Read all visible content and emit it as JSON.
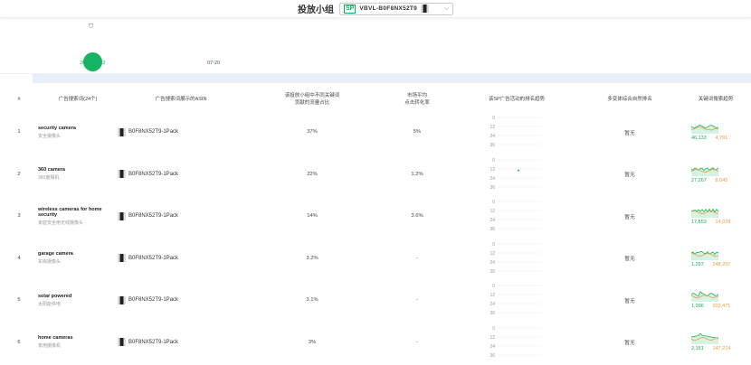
{
  "header": {
    "title": "投放小组",
    "badge": "SP",
    "selected_group": "VBVL-B0F8NX52T9"
  },
  "timeline": {
    "dates": [
      "2025-07-13",
      "07-20"
    ]
  },
  "table": {
    "columns": [
      "#",
      "广告搜索词(24个)",
      "广告搜索词展示的ASIN",
      "该投放小组中不同关键词\n贡献的流量占比",
      "市场平均\n点击转化率",
      "该SP广告活动的排名趋势",
      "多变体综合自然排名",
      "关键词搜索趋势"
    ],
    "rank_ticks": [
      "0",
      "12",
      "24",
      "36"
    ],
    "rows": [
      {
        "index": "1",
        "keyword": "security camera",
        "keyword_cn": "安全摄像头",
        "asin": "B0F8NX52T9-1Pack",
        "traffic_share": "37%",
        "conversion": "5%",
        "natural_rank": "暂无",
        "trend_left": "46,133",
        "trend_right": "4,791",
        "rank_point": null
      },
      {
        "index": "2",
        "keyword": "360 camera",
        "keyword_cn": "360度相机",
        "asin": "B0F8NX52T9-1Pack",
        "traffic_share": "22%",
        "conversion": "1.2%",
        "natural_rank": "暂无",
        "trend_left": "27,267",
        "trend_right": "8,045",
        "rank_point": 14
      },
      {
        "index": "3",
        "keyword": "wireless cameras for home security",
        "keyword_cn": "家庭安全用无线摄像头",
        "asin": "B0F8NX52T9-1Pack",
        "traffic_share": "14%",
        "conversion": "3.6%",
        "natural_rank": "暂无",
        "trend_left": "17,853",
        "trend_right": "14,078",
        "rank_point": null
      },
      {
        "index": "4",
        "keyword": "garage camera",
        "keyword_cn": "车库摄像头",
        "asin": "B0F8NX52T9-1Pack",
        "traffic_share": "3.2%",
        "conversion": "-",
        "natural_rank": "暂无",
        "trend_left": "1,297",
        "trend_right": "248,207",
        "rank_point": null
      },
      {
        "index": "5",
        "keyword": "solar powered",
        "keyword_cn": "太阳能供电",
        "asin": "B0F8NX52T9-1Pack",
        "traffic_share": "3.1%",
        "conversion": "-",
        "natural_rank": "暂无",
        "trend_left": "1,996",
        "trend_right": "203,471",
        "rank_point": null
      },
      {
        "index": "6",
        "keyword": "home cameras",
        "keyword_cn": "家用摄像机",
        "asin": "B0F8NX52T9-1Pack",
        "traffic_share": "3%",
        "conversion": "-",
        "natural_rank": "暂无",
        "trend_left": "2,151",
        "trend_right": "147,274",
        "rank_point": null
      }
    ]
  },
  "colors": {
    "accent": "#14b463",
    "orange": "#f09a3a"
  }
}
